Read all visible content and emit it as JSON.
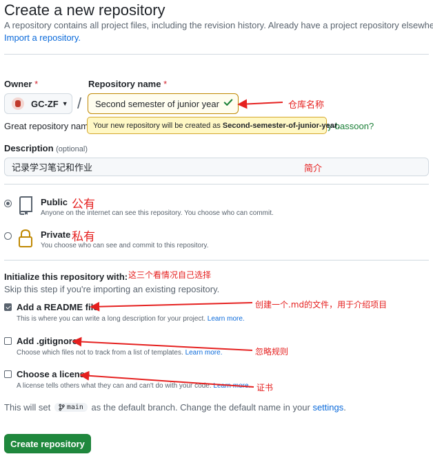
{
  "header": {
    "title": "Create a new repository",
    "subtitle": "A repository contains all project files, including the revision history. Already have a project repository elsewhere?",
    "import_link": "Import a repository."
  },
  "owner": {
    "label": "Owner",
    "required_mark": "*",
    "value": "GC-ZF",
    "separator": "/"
  },
  "repo_name": {
    "label": "Repository name",
    "required_mark": "*",
    "value": "Second semester of junior year"
  },
  "name_hint": {
    "prefix": "Great repository name",
    "suffix": "y-bassoon?",
    "tooltip_prefix": "Your new repository will be created as",
    "tooltip_name": "Second-semester-of-junior-year",
    "tooltip_suffix": "."
  },
  "description": {
    "label": "Description",
    "optional": "(optional)",
    "value": "记录学习笔记和作业"
  },
  "visibility": {
    "public": {
      "title": "Public",
      "desc": "Anyone on the internet can see this repository. You choose who can commit.",
      "selected": true
    },
    "private": {
      "title": "Private",
      "desc": "You choose who can see and commit to this repository.",
      "selected": false
    }
  },
  "init": {
    "title": "Initialize this repository with:",
    "skip_note": "Skip this step if you're importing an existing repository.",
    "readme": {
      "title": "Add a README file",
      "desc": "This is where you can write a long description for your project.",
      "link": "Learn more.",
      "checked": true
    },
    "gitignore": {
      "title": "Add .gitignore",
      "desc": "Choose which files not to track from a list of templates.",
      "link": "Learn more.",
      "checked": false
    },
    "license": {
      "title": "Choose a license",
      "desc": "A license tells others what they can and can't do with your code.",
      "link": "Learn more.",
      "checked": false
    }
  },
  "default_branch": {
    "prefix": "This will set",
    "branch": "main",
    "middle": "as the default branch. Change the default name in your",
    "link": "settings",
    "suffix": "."
  },
  "create_button": "Create repository",
  "annotations": {
    "repo_name": "仓库名称",
    "description": "简介",
    "public": "公有",
    "private": "私有",
    "init": "这三个看情况自己选择",
    "readme": "创建一个.md的文件，用于介绍项目",
    "gitignore": "忽略规则",
    "license": "证书"
  },
  "colors": {
    "accent_link": "#0969da",
    "success_green": "#1f883d",
    "annotation_red": "#e5201f",
    "tooltip_bg": "#fff8c5"
  }
}
